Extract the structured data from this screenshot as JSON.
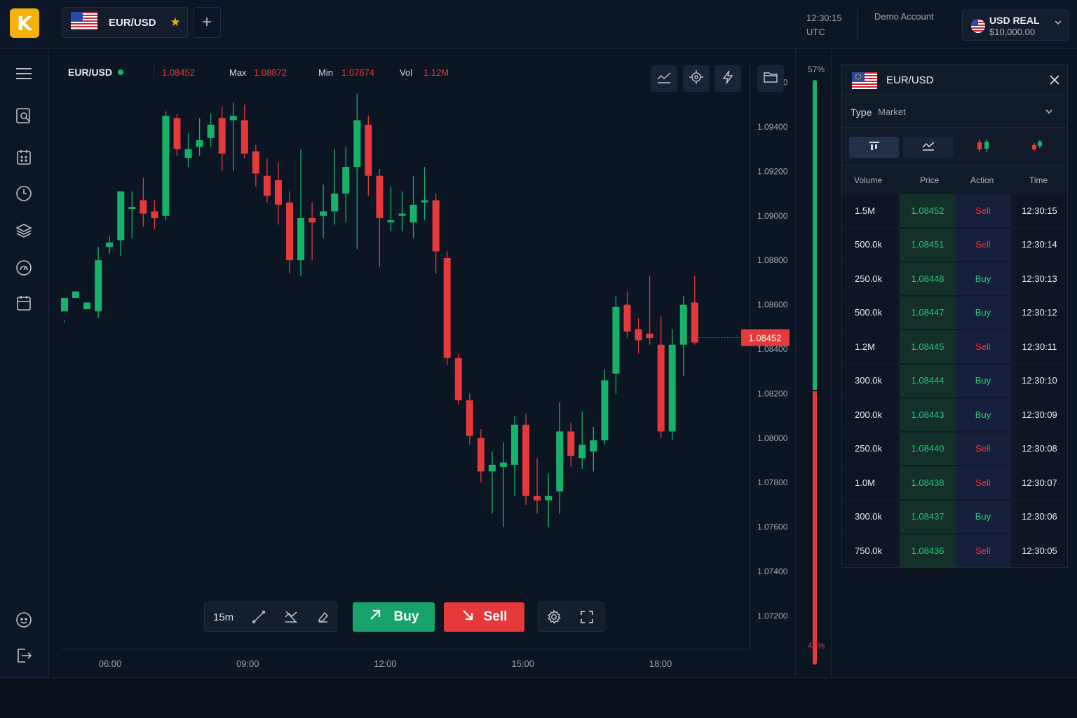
{
  "header": {
    "logo_letter": "K",
    "tab_symbol": "EUR/USD",
    "add_tab_label": "+",
    "clock_time": "12:30:15",
    "clock_tz": "UTC",
    "demo_label": "Demo Account",
    "account_name": "USD REAL",
    "account_balance": "$10,000.00"
  },
  "sidebar": {
    "items": [
      "menu-icon",
      "chart-search-icon",
      "calendar-grid-icon",
      "clock-icon",
      "layers-icon",
      "speed-gauge-icon",
      "calendar-icon",
      "support-icon",
      "logout-icon"
    ]
  },
  "chart_info": {
    "symbol": "EUR/USD",
    "last": "1.08452",
    "max_label": "Max",
    "max_value": "1.08872",
    "min_label": "Min",
    "min_value": "1.07674",
    "vol_label": "Vol",
    "vol_value": "1.12M",
    "current_price_tag": "1.08452"
  },
  "toolbar": {
    "timeframe": "15m",
    "buy_label": "Buy",
    "sell_label": "Sell"
  },
  "ratio": {
    "buy_percent": 57,
    "sell_percent": 43,
    "buy_label": "57%",
    "sell_label": "43%"
  },
  "colors": {
    "up": "#17b26a",
    "down": "#e5393a",
    "accent": "#f5b10a",
    "background": "#0c1524"
  },
  "chart_data": {
    "type": "candlestick",
    "y_ticks": [
      "1.09600",
      "1.09400",
      "1.09200",
      "1.09000",
      "1.08800",
      "1.08600",
      "1.08400",
      "1.08200",
      "1.08000",
      "1.07800",
      "1.07600",
      "1.07400",
      "1.07200"
    ],
    "x_ticks": [
      "06:00",
      "09:00",
      "12:00",
      "15:00",
      "18:00"
    ],
    "ylim": [
      1.0705,
      1.0975
    ],
    "candles": [
      [
        1.0857,
        1.0863,
        1.0853,
        1.0852
      ],
      [
        1.0863,
        1.0866,
        1.0857,
        1.0857
      ],
      [
        1.0858,
        1.0861,
        1.0851,
        1.0851
      ],
      [
        1.0857,
        1.088,
        1.0854,
        1.0886
      ],
      [
        1.0886,
        1.0888,
        1.0883,
        1.0891
      ],
      [
        1.0889,
        1.0911,
        1.0882,
        1.0904
      ],
      [
        1.0904,
        1.0904,
        1.089,
        1.0911
      ],
      [
        1.0907,
        1.0901,
        1.0895,
        1.0917
      ],
      [
        1.0902,
        1.0899,
        1.0894,
        1.0907
      ],
      [
        1.09,
        1.0945,
        1.0898,
        1.0947
      ],
      [
        1.0944,
        1.093,
        1.0927,
        1.0946
      ],
      [
        1.0926,
        1.093,
        1.0922,
        1.0937
      ],
      [
        1.0931,
        1.0934,
        1.0927,
        1.0944
      ],
      [
        1.0935,
        1.0941,
        1.0931,
        1.0946
      ],
      [
        1.0944,
        1.0928,
        1.092,
        1.0949
      ],
      [
        1.0943,
        1.0945,
        1.092,
        1.0951
      ],
      [
        1.0943,
        1.0928,
        1.0926,
        1.095
      ],
      [
        1.0929,
        1.0919,
        1.0913,
        1.0932
      ],
      [
        1.0918,
        1.0909,
        1.0906,
        1.0926
      ],
      [
        1.0916,
        1.0905,
        1.0896,
        1.0924
      ],
      [
        1.0906,
        1.088,
        1.0874,
        1.0911
      ],
      [
        1.088,
        1.0899,
        1.0873,
        1.093
      ],
      [
        1.0899,
        1.0897,
        1.088,
        1.0906
      ],
      [
        1.09,
        1.0902,
        1.089,
        1.0914
      ],
      [
        1.0902,
        1.091,
        1.0896,
        1.093
      ],
      [
        1.091,
        1.0922,
        1.0897,
        1.0931
      ],
      [
        1.0922,
        1.0943,
        1.0885,
        1.0955
      ],
      [
        1.0941,
        1.0918,
        1.0909,
        1.0945
      ],
      [
        1.0918,
        1.0899,
        1.0877,
        1.0921
      ],
      [
        1.0898,
        1.0898,
        1.0893,
        1.0913
      ],
      [
        1.09,
        1.0901,
        1.0893,
        1.0911
      ],
      [
        1.0897,
        1.0905,
        1.089,
        1.0918
      ],
      [
        1.0907,
        1.0907,
        1.0898,
        1.0922
      ],
      [
        1.0907,
        1.0884,
        1.0874,
        1.091
      ],
      [
        1.0881,
        1.0836,
        1.0833,
        1.0884
      ],
      [
        1.0836,
        1.0817,
        1.0815,
        1.0838
      ],
      [
        1.0817,
        1.0801,
        1.0797,
        1.082
      ],
      [
        1.08,
        1.0785,
        1.078,
        1.0804
      ],
      [
        1.0785,
        1.0788,
        1.0766,
        1.0794
      ],
      [
        1.0787,
        1.0789,
        1.076,
        1.0798
      ],
      [
        1.0788,
        1.0806,
        1.0774,
        1.081
      ],
      [
        1.0806,
        1.0774,
        1.077,
        1.0811
      ],
      [
        1.0774,
        1.0772,
        1.0766,
        1.0791
      ],
      [
        1.0772,
        1.0774,
        1.076,
        1.0784
      ],
      [
        1.0776,
        1.0803,
        1.0766,
        1.0816
      ],
      [
        1.0803,
        1.0792,
        1.0787,
        1.0807
      ],
      [
        1.0791,
        1.0797,
        1.0786,
        1.0812
      ],
      [
        1.0794,
        1.0799,
        1.0785,
        1.0805
      ],
      [
        1.0799,
        1.0826,
        1.0797,
        1.0831
      ],
      [
        1.0829,
        1.0859,
        1.082,
        1.0864
      ],
      [
        1.086,
        1.0848,
        1.0845,
        1.0866
      ],
      [
        1.0849,
        1.0844,
        1.0838,
        1.0854
      ],
      [
        1.0847,
        1.0845,
        1.0842,
        1.0873
      ],
      [
        1.0842,
        1.0803,
        1.08,
        1.0855
      ],
      [
        1.0803,
        1.0842,
        1.0799,
        1.0849
      ],
      [
        1.0842,
        1.086,
        1.0828,
        1.0864
      ],
      [
        1.0861,
        1.0843,
        1.0842,
        1.0873
      ]
    ]
  },
  "panel": {
    "title": "EUR/USD",
    "type_label": "Type",
    "type_value": "Market",
    "columns": [
      "Volume",
      "Price",
      "Action",
      "Time"
    ],
    "rows": [
      {
        "volume": "1.5M",
        "price": "1.08452",
        "action": "Sell",
        "time": "12:30:15"
      },
      {
        "volume": "500.0k",
        "price": "1.08451",
        "action": "Sell",
        "time": "12:30:14"
      },
      {
        "volume": "250.0k",
        "price": "1.08448",
        "action": "Buy",
        "time": "12:30:13"
      },
      {
        "volume": "500.0k",
        "price": "1.08447",
        "action": "Buy",
        "time": "12:30:12"
      },
      {
        "volume": "1.2M",
        "price": "1.08445",
        "action": "Sell",
        "time": "12:30:11"
      },
      {
        "volume": "300.0k",
        "price": "1.08444",
        "action": "Buy",
        "time": "12:30:10"
      },
      {
        "volume": "200.0k",
        "price": "1.08443",
        "action": "Buy",
        "time": "12:30:09"
      },
      {
        "volume": "250.0k",
        "price": "1.08440",
        "action": "Sell",
        "time": "12:30:08"
      },
      {
        "volume": "1.0M",
        "price": "1.08438",
        "action": "Sell",
        "time": "12:30:07"
      },
      {
        "volume": "300.0k",
        "price": "1.08437",
        "action": "Buy",
        "time": "12:30:06"
      },
      {
        "volume": "750.0k",
        "price": "1.08436",
        "action": "Sell",
        "time": "12:30:05"
      }
    ]
  }
}
